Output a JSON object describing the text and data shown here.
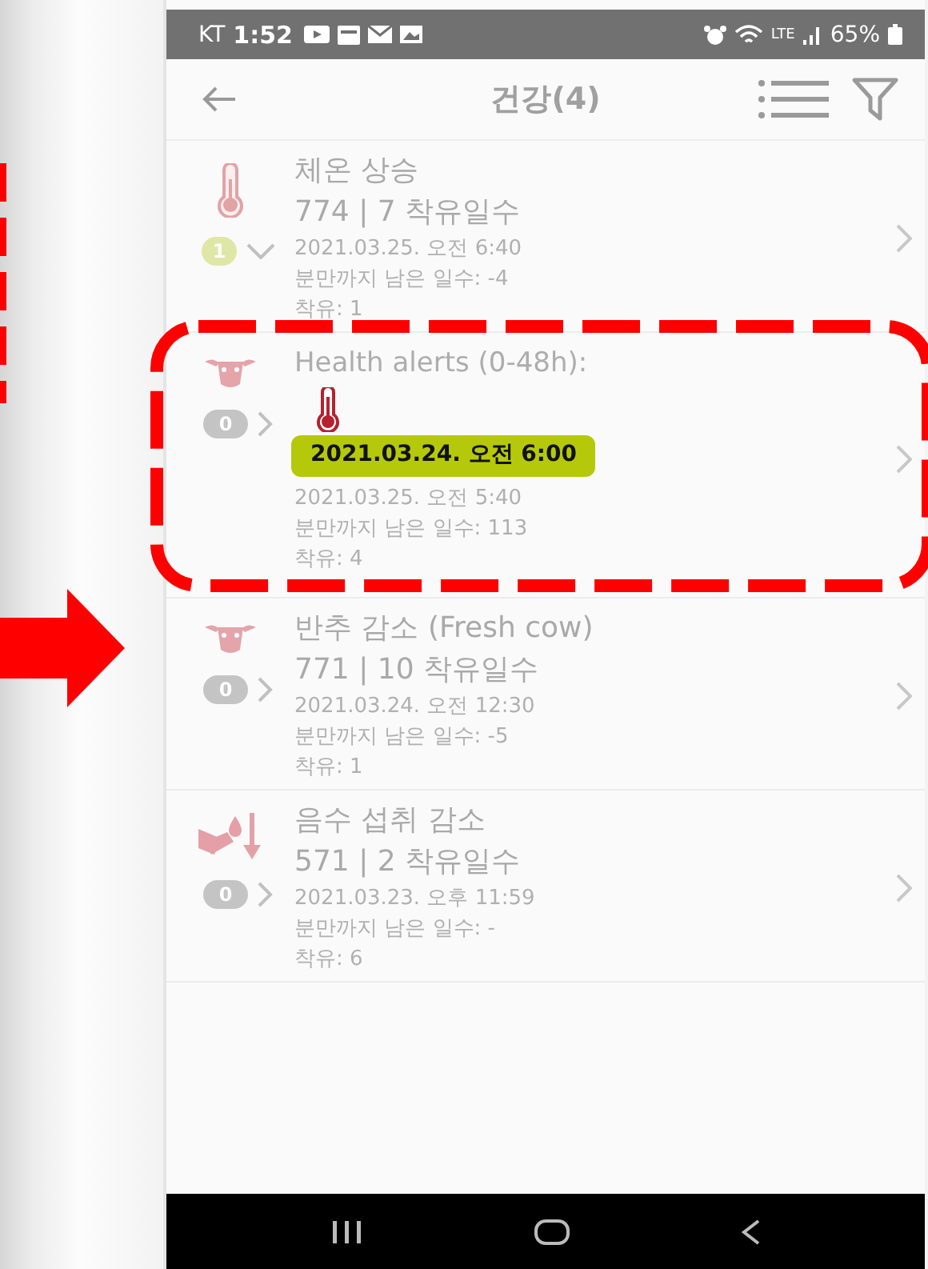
{
  "status_bar": {
    "carrier": "KT",
    "time": "1:52",
    "network": "LTE",
    "battery": "65%"
  },
  "header": {
    "title": "건강(4)"
  },
  "alerts": [
    {
      "kind": "temperature",
      "title": "체온 상승",
      "subtitle": "774 | 7 착유일수",
      "date": "2021.03.25. 오전 6:40",
      "days_to_calving": "분만까지 남은 일수: -4",
      "milking": "착유: 1",
      "count": "1",
      "expanded": true
    },
    {
      "kind": "rumination",
      "popup": {
        "title": "Health alerts (0-48h):",
        "date": "2021.03.24. 오전 6:00"
      },
      "date": "2021.03.25. 오전 5:40",
      "days_to_calving": "분만까지 남은 일수: 113",
      "milking": "착유: 4",
      "count": "0",
      "expanded": false
    },
    {
      "kind": "rumination",
      "title": "반추 감소 (Fresh cow)",
      "subtitle": "771 | 10 착유일수",
      "date": "2021.03.24. 오전 12:30",
      "days_to_calving": "분만까지 남은 일수: -5",
      "milking": "착유: 1",
      "count": "0",
      "expanded": false
    },
    {
      "kind": "water",
      "title": "음수 섭취 감소",
      "subtitle": "571 | 2 착유일수",
      "date": "2021.03.23. 오후 11:59",
      "days_to_calving": "분만까지 남은 일수: -",
      "milking": "착유: 6",
      "count": "0",
      "expanded": false
    }
  ]
}
